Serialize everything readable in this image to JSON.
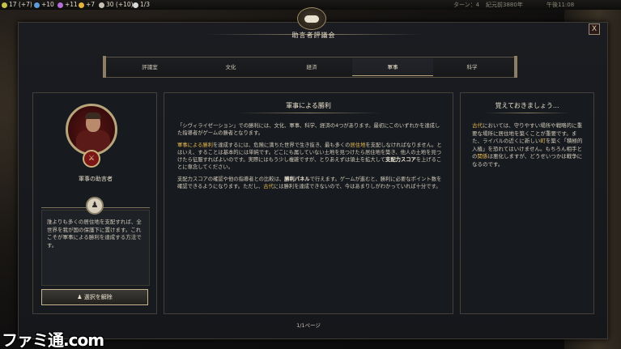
{
  "topbar": {
    "resources": [
      {
        "name": "food",
        "value": "17 (+7)",
        "color": "#c9c24a"
      },
      {
        "name": "science",
        "value": "+10",
        "color": "#5b9bd8"
      },
      {
        "name": "culture",
        "value": "+11",
        "color": "#b46fd8"
      },
      {
        "name": "happiness",
        "value": "+7",
        "color": "#e2b33a"
      },
      {
        "name": "gold",
        "value": "30 (+10)",
        "color": "#c7c2b4"
      },
      {
        "name": "faith",
        "value": "1/3",
        "color": "#d8d8d8"
      }
    ],
    "turn": "ターン：4",
    "year": "紀元前3880年",
    "clock": "午後11:08"
  },
  "dialog": {
    "title": "助言者評議会",
    "close_label": "X",
    "tabs": [
      {
        "label": "評議室",
        "active": false
      },
      {
        "label": "文化",
        "active": false
      },
      {
        "label": "経済",
        "active": false
      },
      {
        "label": "軍事",
        "active": true
      },
      {
        "label": "科学",
        "active": false
      }
    ]
  },
  "advisor": {
    "emblem": "⚔",
    "name": "軍事の助言者",
    "description": "誰よりも多くの居住地を支配すれば、全世界を我が国の保護下に置けます。これこそが軍事による勝利を達成する方法です。",
    "deselect_label": "選択を解除"
  },
  "main": {
    "title": "軍事による勝利",
    "para1": "「シヴィライゼーション」での勝利には、文化、軍事、科学、経済の4つがあります。最初にこのいずれかを達成した指導者がゲームの勝者となります。",
    "para2_prefix": "",
    "para2_hl1": "軍事による勝利",
    "para2_mid1": "を達成するには、危険に満ちた世界で生き抜き、最も多くの",
    "para2_hl2": "居住地",
    "para2_mid2": "を支配しなければなりません。とはいえ、することは基本的には単純です。どこにも属していない土地を見つけたら居住地を築き、他人の土地を見つけたら征服すればよいのです。実際にはもう少し複雑ですが、とりあえずは領土を拡大して",
    "para2_bold": "支配力スコア",
    "para2_end": "を上げることに専念してください。",
    "para3_prefix": "支配力スコアの確認や他の指導者との比較は、",
    "para3_bold": "勝利パネル",
    "para3_mid": "で行えます。ゲームが進むと、勝利に必要なポイント数を確認できるようになります。ただし、",
    "para3_hl": "古代",
    "para3_end": "には勝利を達成できないので、今はあまりしがわかっていれば十分です。",
    "page": "1/1ページ"
  },
  "tips": {
    "title": "覚えておきましょう...",
    "hl1": "古代",
    "text1": "においては、守りやすい場所や戦略的に重要な場所に居住地を築くことが重要です。また、ライバルの近くに新しい",
    "hl2": "町",
    "text2": "を築く「積極的入植」を恐れてはいけません。もちろん相手との",
    "hl3": "関係",
    "text3": "は悪化しますが、どうせいつかは戦争になるのです。"
  },
  "watermark": "ファミ通.com"
}
